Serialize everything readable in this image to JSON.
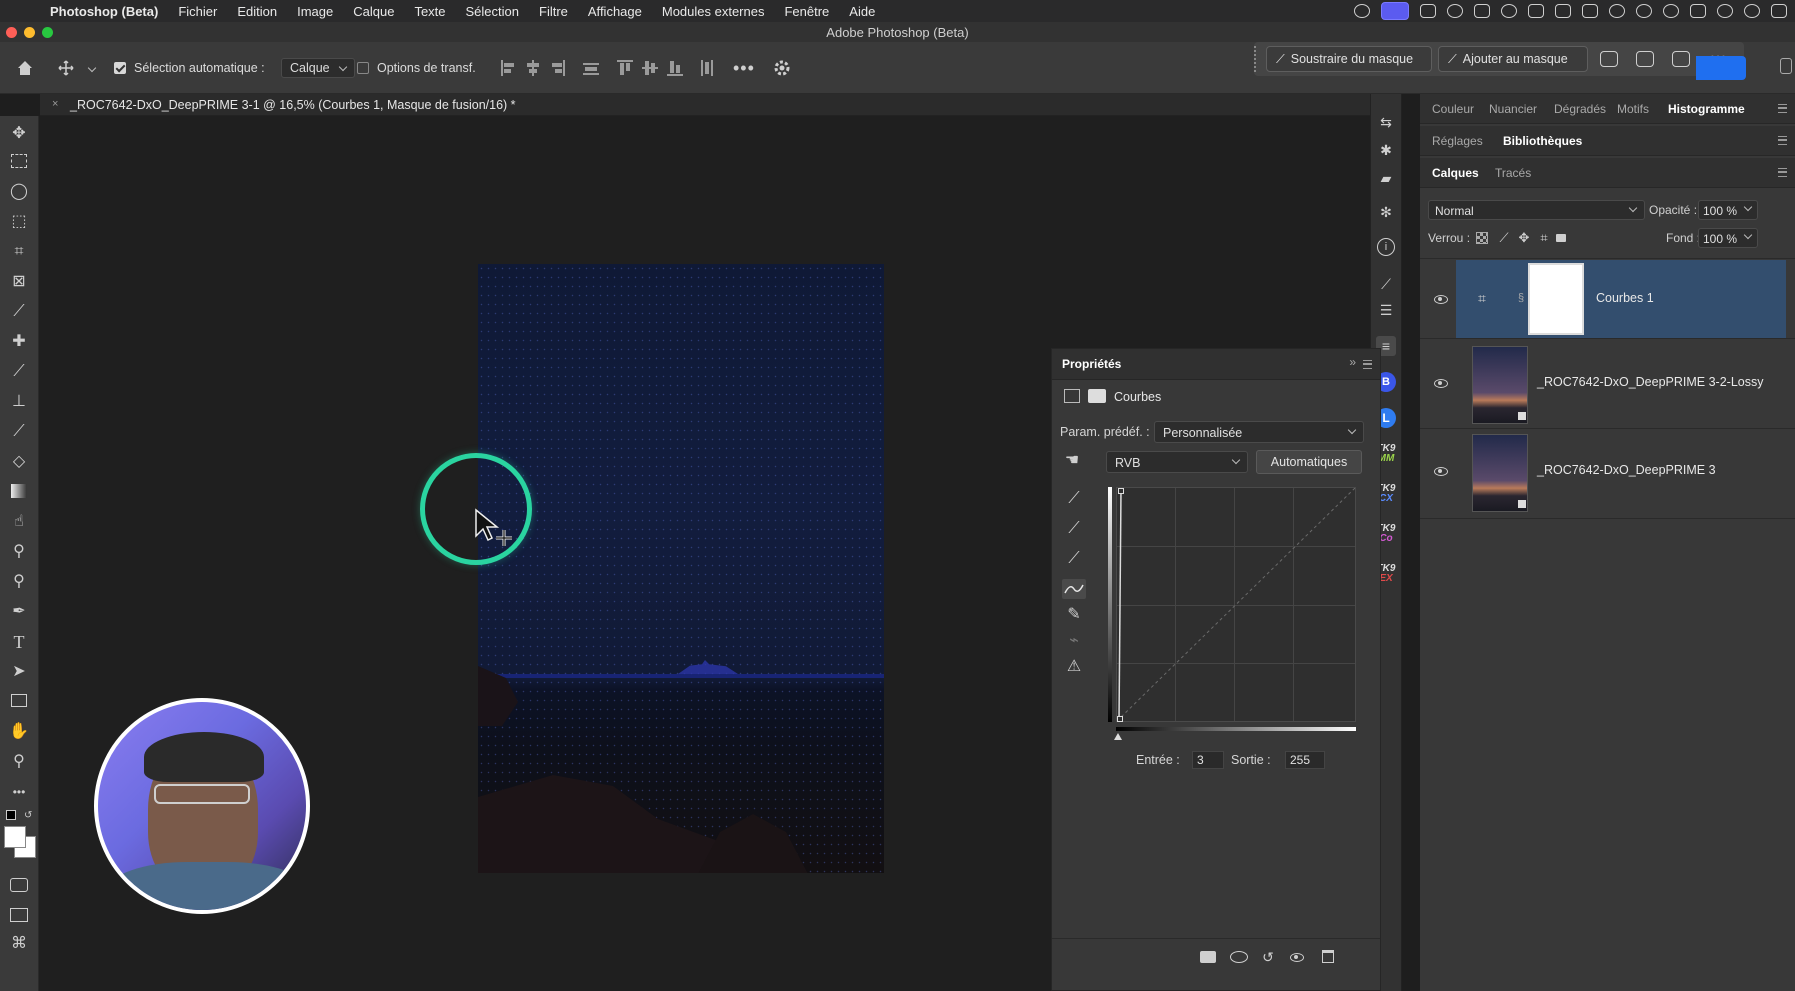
{
  "menubar": {
    "app_name": "Photoshop (Beta)",
    "items": [
      "Fichier",
      "Edition",
      "Image",
      "Calque",
      "Texte",
      "Sélection",
      "Filtre",
      "Affichage",
      "Modules externes",
      "Fenêtre",
      "Aide"
    ]
  },
  "window": {
    "title": "Adobe Photoshop (Beta)"
  },
  "options_bar": {
    "auto_select_label": "Sélection automatique :",
    "auto_select_value": "Calque",
    "transform_label": "Options de transf.",
    "subtract_mask_label": "Soustraire du masque",
    "add_mask_label": "Ajouter au masque"
  },
  "document": {
    "tab_title": "_ROC7642-DxO_DeepPRIME 3-1 @ 16,5% (Courbes 1, Masque de fusion/16) *"
  },
  "panel_tabs": {
    "row1": [
      "Couleur",
      "Nuancier",
      "Dégradés",
      "Motifs",
      "Histogramme"
    ],
    "row2": [
      "Réglages",
      "Bibliothèques"
    ],
    "row3": [
      "Calques",
      "Tracés"
    ]
  },
  "layers_panel": {
    "blend_mode": "Normal",
    "opacity_label": "Opacité :",
    "opacity_value": "100 %",
    "lock_label": "Verrou :",
    "fill_label": "Fond :",
    "fill_value": "100 %",
    "layers": [
      {
        "name": "Courbes 1",
        "selected": true
      },
      {
        "name": "_ROC7642-DxO_DeepPRIME 3-2-Lossy",
        "selected": false
      },
      {
        "name": "_ROC7642-DxO_DeepPRIME 3",
        "selected": false
      }
    ]
  },
  "properties": {
    "title": "Propriétés",
    "adjustment_name": "Courbes",
    "preset_label": "Param. prédéf. :",
    "preset_value": "Personnalisée",
    "channel_value": "RVB",
    "auto_button": "Automatiques",
    "input_label": "Entrée :",
    "input_value": "3",
    "output_label": "Sortie :",
    "output_value": "255"
  },
  "strip_labels": {
    "tk1_top": "TK9",
    "tk1_bottom": "MM",
    "tk2_top": "TK9",
    "tk2_bottom": "CX",
    "tk3_top": "TK9",
    "tk3_bottom": "Co",
    "tk4_top": "TK9",
    "tk4_bottom": "EX"
  },
  "colors": {
    "cursor_ring": "#2ad4a0",
    "selected_layer": "#334e6e",
    "tk_mm": "#9bd44a",
    "tk_cx": "#5a8cff",
    "tk_co": "#d05ad0",
    "tk_ex": "#e04a4a"
  }
}
